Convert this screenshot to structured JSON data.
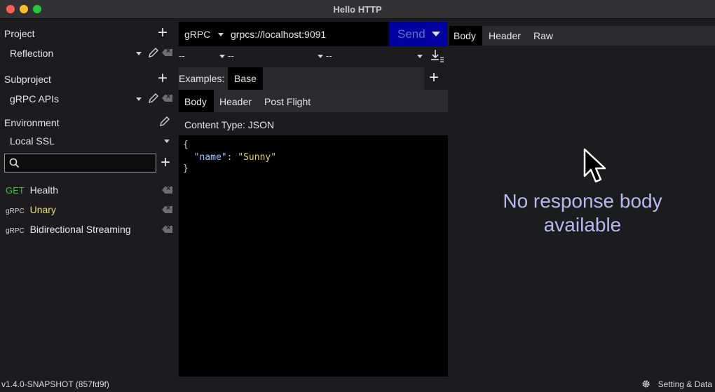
{
  "window": {
    "title": "Hello HTTP"
  },
  "sidebar": {
    "project_label": "Project",
    "project_value": "Reflection",
    "subproject_label": "Subproject",
    "subproject_value": "gRPC APIs",
    "environment_label": "Environment",
    "environment_value": "Local SSL",
    "search": {
      "placeholder": ""
    },
    "requests": [
      {
        "method": "GET",
        "name": "Health"
      },
      {
        "method": "gRPC",
        "name": "Unary"
      },
      {
        "method": "gRPC",
        "name": "Bidirectional Streaming"
      }
    ]
  },
  "request": {
    "protocol": "gRPC",
    "url": "grpcs://localhost:9091",
    "send_label": "Send",
    "kv_placeholders": [
      "--",
      "--",
      "--"
    ],
    "examples_label": "Examples:",
    "example_tab": "Base",
    "tabs": [
      "Body",
      "Header",
      "Post Flight"
    ],
    "content_type": "Content Type: JSON",
    "body_json": {
      "open": "{",
      "key": "\"name\"",
      "colon": ": ",
      "value": "\"Sunny\"",
      "close": "}"
    }
  },
  "response": {
    "tabs": [
      "Body",
      "Header",
      "Raw"
    ],
    "empty_line1": "No response body",
    "empty_line2": "available"
  },
  "status": {
    "version": "v1.4.0-SNAPSHOT (857fd9f)",
    "settings_label": "Setting & Data"
  },
  "colors": {
    "send_button": "#00009e",
    "get_method": "#3fbf3f",
    "grpc_selected_name": "#e8e070",
    "empty_message": "#b8b8f0"
  },
  "icons": {
    "add": "plus-icon",
    "edit": "pencil-icon",
    "delete": "backspace-delete-icon",
    "search": "magnifier-icon",
    "settings": "gear-icon",
    "download": "download-icon"
  }
}
